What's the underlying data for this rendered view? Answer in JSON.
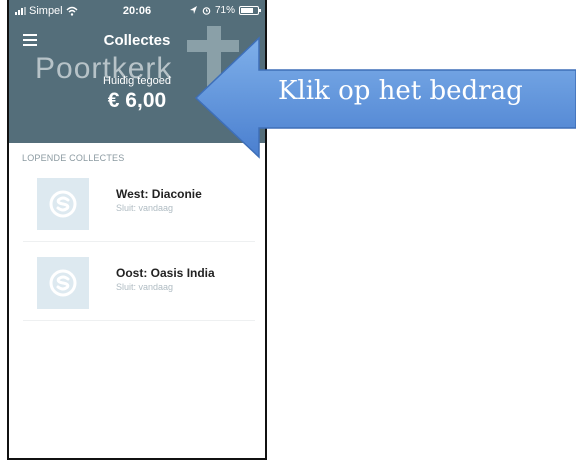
{
  "status_bar": {
    "carrier": "Simpel",
    "time": "20:06",
    "battery": "71%"
  },
  "header": {
    "title": "Collectes",
    "logo_text": "Poortkerk",
    "balance_label": "Huidig tegoed",
    "balance": "€ 6,00",
    "background_color": "#546e7a"
  },
  "section": {
    "label": "LOPENDE COLLECTES"
  },
  "collectes": [
    {
      "title": "West: Diaconie",
      "subtitle": "Sluit: vandaag"
    },
    {
      "title": "Oost: Oasis India",
      "subtitle": "Sluit: vandaag"
    }
  ],
  "callout": {
    "text": "Klik op het bedrag",
    "color": "#5b8fd6"
  }
}
